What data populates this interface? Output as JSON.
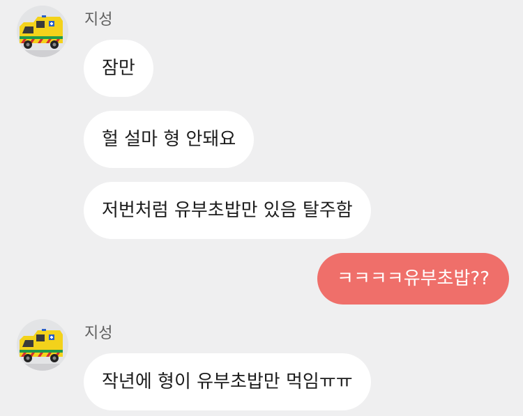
{
  "colors": {
    "background": "#efeff0",
    "incoming_bubble": "#ffffff",
    "outgoing_bubble": "#ef6f6a",
    "ambulance_yellow": "#f3d21b"
  },
  "conversation": {
    "groups": [
      {
        "sender_name": "지성",
        "avatar_icon": "ambulance-icon",
        "messages": [
          "잠만",
          "헐 설마 형 안돼요",
          "저번처럼 유부초밥만 있음 탈주함"
        ]
      },
      {
        "from_me": true,
        "messages": [
          "ㅋㅋㅋㅋ유부초밥??"
        ]
      },
      {
        "sender_name": "지성",
        "avatar_icon": "ambulance-icon",
        "messages": [
          "작년에 형이 유부초밥만 먹임ㅠㅠ"
        ]
      }
    ]
  }
}
